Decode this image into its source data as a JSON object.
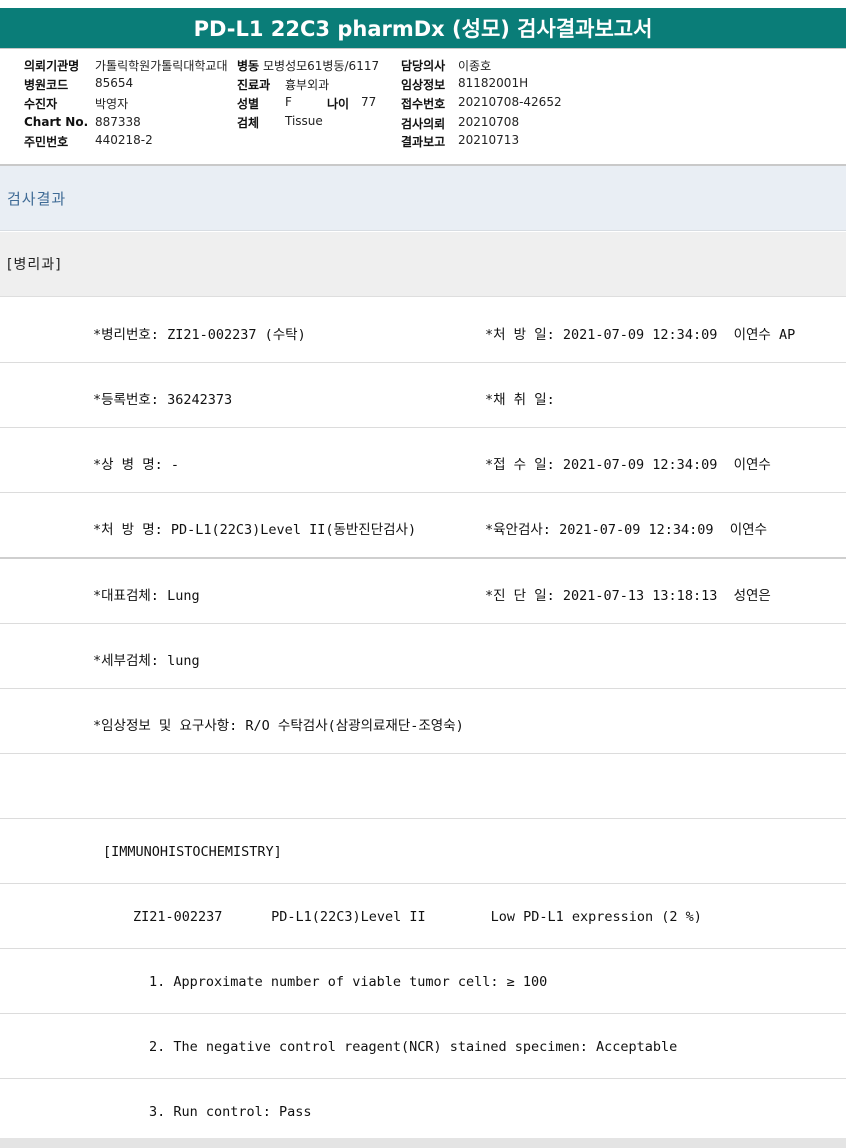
{
  "report": {
    "title": "PD-L1 22C3 pharmDx (성모) 검사결과보고서"
  },
  "patient_info": {
    "requesting_org": {
      "label": "의뢰기관명",
      "value": "가톨릭학원가톨릭대학교대"
    },
    "ward": {
      "label": "병동",
      "value": "모병성모61병동/6117"
    },
    "doctor": {
      "label": "담당의사",
      "value": "이종호"
    },
    "hospital_code": {
      "label": "병원코드",
      "value": "85654"
    },
    "department": {
      "label": "진료과",
      "value": "흉부외과"
    },
    "clinical_info": {
      "label": "임상정보",
      "value": "81182001H"
    },
    "examinee": {
      "label": "수진자",
      "value": "박영자"
    },
    "sex": {
      "label": "성별",
      "value": "F"
    },
    "age": {
      "label": "나이",
      "value": "77"
    },
    "receipt_no": {
      "label": "접수번호",
      "value": "20210708-42652"
    },
    "chart_no": {
      "label": "Chart No.",
      "value": "887338"
    },
    "specimen": {
      "label": "검체",
      "value": "Tissue"
    },
    "test_request": {
      "label": "검사의뢰",
      "value": "20210708"
    },
    "resident_no": {
      "label": "주민번호",
      "value": "440218-2"
    },
    "result_report": {
      "label": "결과보고",
      "value": "20210713"
    }
  },
  "sections": {
    "results_title": "검사결과",
    "pathology_title": "[병리과]"
  },
  "result_rows": [
    {
      "left": "*병리번호: ZI21-002237 (수탁)",
      "right": "*처 방 일: 2021-07-09 12:34:09  이연수 AP"
    },
    {
      "left": "*등록번호: 36242373",
      "right": "*채 취 일:"
    },
    {
      "left": "*상 병 명: -",
      "right": "*접 수 일: 2021-07-09 12:34:09  이연수"
    },
    {
      "left": "*처 방 명: PD-L1(22C3)Level II(동반진단검사)",
      "right": "*육안검사: 2021-07-09 12:34:09  이연수"
    },
    {
      "left": "*대표검체: Lung",
      "right": "*진 단 일: 2021-07-13 13:18:13  성연은"
    },
    {
      "left": "*세부검체: lung",
      "right": ""
    },
    {
      "left": "*임상정보 및 요구사항: R/O 수탁검사(삼광의료재단-조영숙)",
      "right": ""
    },
    {
      "left": "",
      "right": ""
    },
    {
      "left": "[IMMUNOHISTOCHEMISTRY]",
      "right": ""
    },
    {
      "left": "ZI21-002237      PD-L1(22C3)Level II        Low PD-L1 expression (2 %)",
      "right": ""
    },
    {
      "left": "1. Approximate number of viable tumor cell: ≥ 100",
      "right": ""
    },
    {
      "left": "2. The negative control reagent(NCR) stained specimen: Acceptable",
      "right": ""
    },
    {
      "left": "3. Run control: Pass",
      "right": ""
    }
  ]
}
